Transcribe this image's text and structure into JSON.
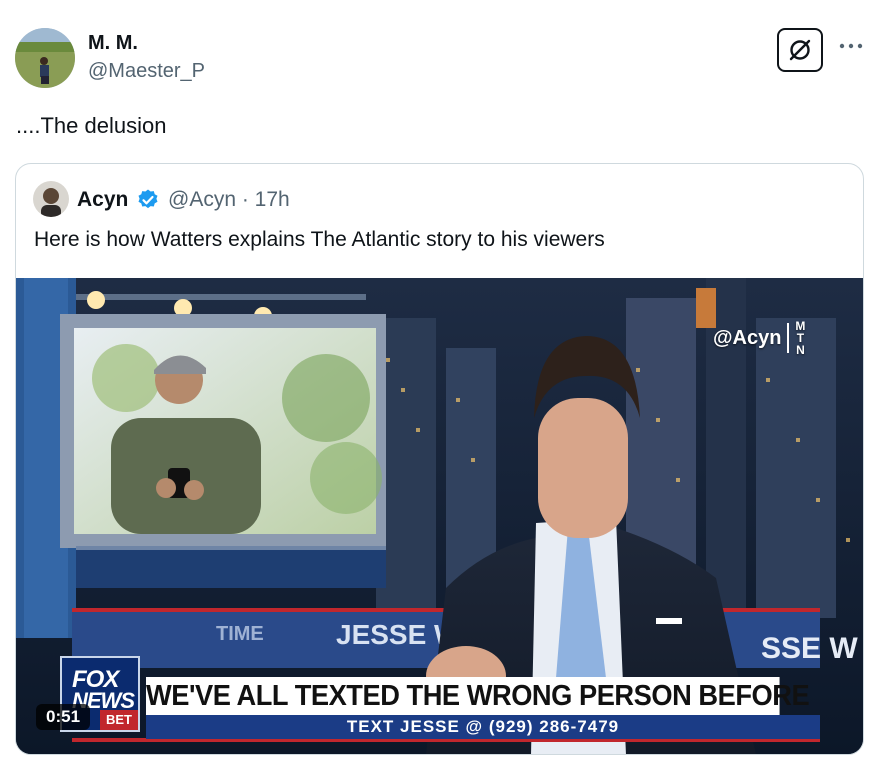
{
  "post": {
    "author_name": "M. M.",
    "author_handle": "@Maester_P",
    "text": "....The delusion"
  },
  "quoted": {
    "author_name": "Acyn",
    "author_handle": "@Acyn · 17h",
    "text": "Here is how Watters explains The Atlantic story to his viewers",
    "video": {
      "watermark": "@Acyn",
      "watermark_logo": [
        "M",
        "T",
        "N"
      ],
      "set_left_text": "TIME",
      "set_jesse_text": "JESSE W",
      "set_right_text": "SSE W",
      "fox_logo_top": "FOX",
      "fox_logo_mid": "NEWS",
      "fox_logo_bottom": "BET",
      "banner": "WE'VE ALL TEXTED THE WRONG PERSON BEFORE",
      "subbar": "TEXT JESSE @ (929) 286-7479",
      "duration": "0:51"
    }
  },
  "colors": {
    "text": "#0f1419",
    "secondary": "#536471",
    "border": "#cfd9de",
    "verified": "#1d9bf0",
    "fox_blue": "#0b2b6f",
    "fox_red": "#c1272d"
  },
  "icons": {
    "grok": "grok-icon",
    "more": "more-icon",
    "verified": "verified-badge-icon"
  }
}
